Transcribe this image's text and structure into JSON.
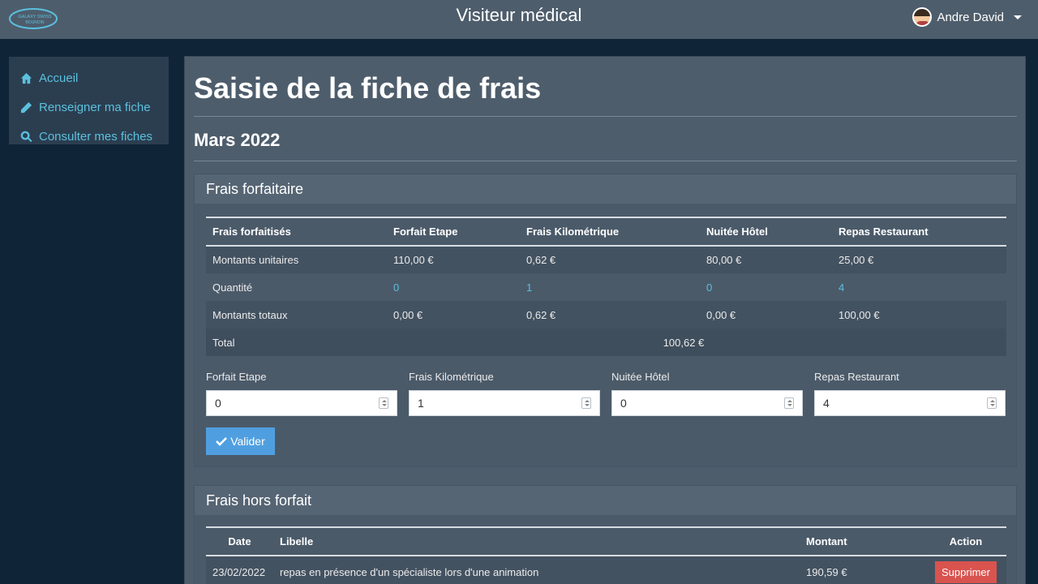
{
  "header": {
    "logo_line1": "GALAXY SWISS",
    "logo_line2": "BOURDIN",
    "title": "Visiteur médical",
    "user_name": "Andre David"
  },
  "sidebar": {
    "items": [
      {
        "label": "Accueil",
        "icon": "home-icon"
      },
      {
        "label": "Renseigner ma fiche",
        "icon": "pencil-icon"
      },
      {
        "label": "Consulter mes fiches",
        "icon": "search-icon"
      }
    ]
  },
  "main": {
    "title": "Saisie de la fiche de frais",
    "month": "Mars 2022"
  },
  "forfait": {
    "panel_title": "Frais forfaitaire",
    "headers": [
      "Frais forfaitisés",
      "Forfait Etape",
      "Frais Kilométrique",
      "Nuitée Hôtel",
      "Repas Restaurant"
    ],
    "rows": [
      [
        "Montants unitaires",
        "110,00 €",
        "0,62 €",
        "80,00 €",
        "25,00 €"
      ],
      [
        "Quantité",
        "0",
        "1",
        "0",
        "4"
      ],
      [
        "Montants totaux",
        "0,00 €",
        "0,62 €",
        "0,00 €",
        "100,00 €"
      ]
    ],
    "total_label": "Total",
    "total_value": "100,62 €",
    "fields": [
      {
        "label": "Forfait Etape",
        "value": "0"
      },
      {
        "label": "Frais Kilométrique",
        "value": "1"
      },
      {
        "label": "Nuitée Hôtel",
        "value": "0"
      },
      {
        "label": "Repas Restaurant",
        "value": "4"
      }
    ],
    "submit_label": "Valider"
  },
  "hors_forfait": {
    "panel_title": "Frais hors forfait",
    "headers": [
      "Date",
      "Libelle",
      "Montant",
      "Action"
    ],
    "rows": [
      {
        "date": "23/02/2022",
        "libelle": "repas en présence d'un spécialiste lors d'une animation",
        "montant": "190,59 €",
        "action": "Supprimer"
      }
    ]
  },
  "colors": {
    "navbar": "#4e5d6c",
    "background": "#0f2537",
    "link": "#5bc0de",
    "primary": "#4f9fe0",
    "danger": "#d9534f"
  }
}
